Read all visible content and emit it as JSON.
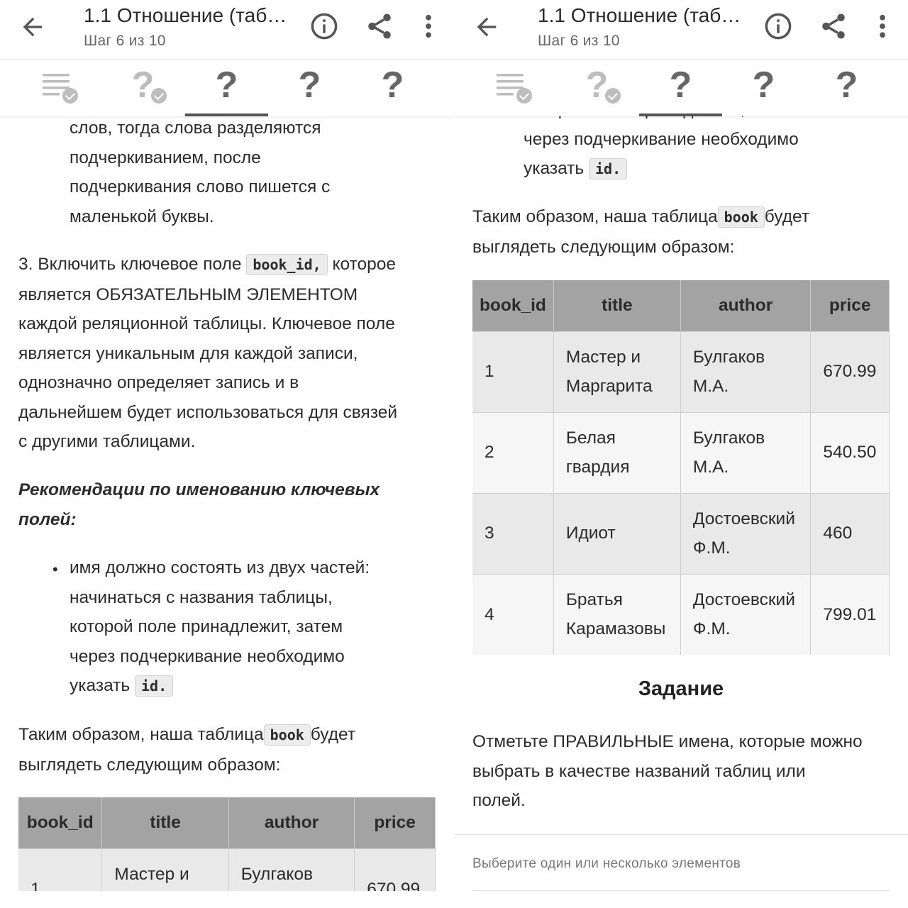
{
  "appbar": {
    "title": "1.1 Отношение (таб…",
    "subtitle": "Шаг 6 из 10"
  },
  "steps": [
    {
      "glyph": "≡",
      "state": "done"
    },
    {
      "glyph": "?",
      "state": "done"
    },
    {
      "glyph": "?",
      "state": "active"
    },
    {
      "glyph": "?",
      "state": "todo"
    },
    {
      "glyph": "?",
      "state": "todo"
    }
  ],
  "left": {
    "p_top_lines": [
      "слов, тогда слова разделяются",
      "подчеркиванием, после",
      "подчеркивания слово пишется с",
      "маленькой буквы."
    ],
    "p3_lead": "3. Включить ключевое поле ",
    "p3_code": "book_id,",
    "p3_tail": " которое",
    "p3_lines": [
      "является ОБЯЗАТЕЛЬНЫМ ЭЛЕМЕНТОМ",
      "каждой реляционной таблицы. Ключевое поле",
      "является уникальным для каждой записи,",
      "однозначно определяет запись и в",
      "дальнейшем будет использоваться для связей",
      "с другими таблицами."
    ],
    "rec_lines": [
      "Рекомендации по именованию  ключевых",
      "полей:"
    ],
    "bullet_lines": [
      "имя должно состоять  из двух частей:",
      "начинаться с названия таблицы,",
      "которой поле принадлежит,   затем",
      "через подчеркивание необходимо"
    ],
    "bullet_last_lead": "указать ",
    "bullet_code": "id.",
    "summary_lead": "Таким образом, наша таблица",
    "summary_code": "book",
    "summary_tail": "будет",
    "summary_line2": "выглядеть следующим образом:"
  },
  "right": {
    "clipped_top": "которой поле принадлежит,   затем",
    "bullet_lines": [
      "через подчеркивание необходимо"
    ],
    "bullet_last_lead": "указать ",
    "bullet_code": "id.",
    "summary_lead": "Таким образом, наша таблица",
    "summary_code": "book",
    "summary_tail": "будет",
    "summary_line2": "выглядеть следующим образом:",
    "task_heading": "Задание",
    "task_lines": [
      "Отметьте ПРАВИЛЬНЫЕ имена, которые можно",
      "выбрать в качестве названий таблиц или",
      "полей."
    ],
    "hint": "Выберите один или несколько элементов"
  },
  "table": {
    "headers": [
      "book_id",
      "title",
      "author",
      "price"
    ],
    "rows": [
      {
        "id": "1",
        "title": [
          "Мастер и",
          "Маргарита"
        ],
        "author": [
          "Булгаков",
          "М.А."
        ],
        "price": "670.99"
      },
      {
        "id": "2",
        "title": [
          "Белая",
          "гвардия"
        ],
        "author": [
          "Булгаков",
          "М.А."
        ],
        "price": "540.50"
      },
      {
        "id": "3",
        "title": [
          "Идиот"
        ],
        "author": [
          "Достоевский",
          "Ф.М."
        ],
        "price": "460"
      },
      {
        "id": "4",
        "title": [
          "Братья",
          "Карамазовы"
        ],
        "author": [
          "Достоевский",
          "Ф.М."
        ],
        "price": "799.01"
      }
    ]
  }
}
